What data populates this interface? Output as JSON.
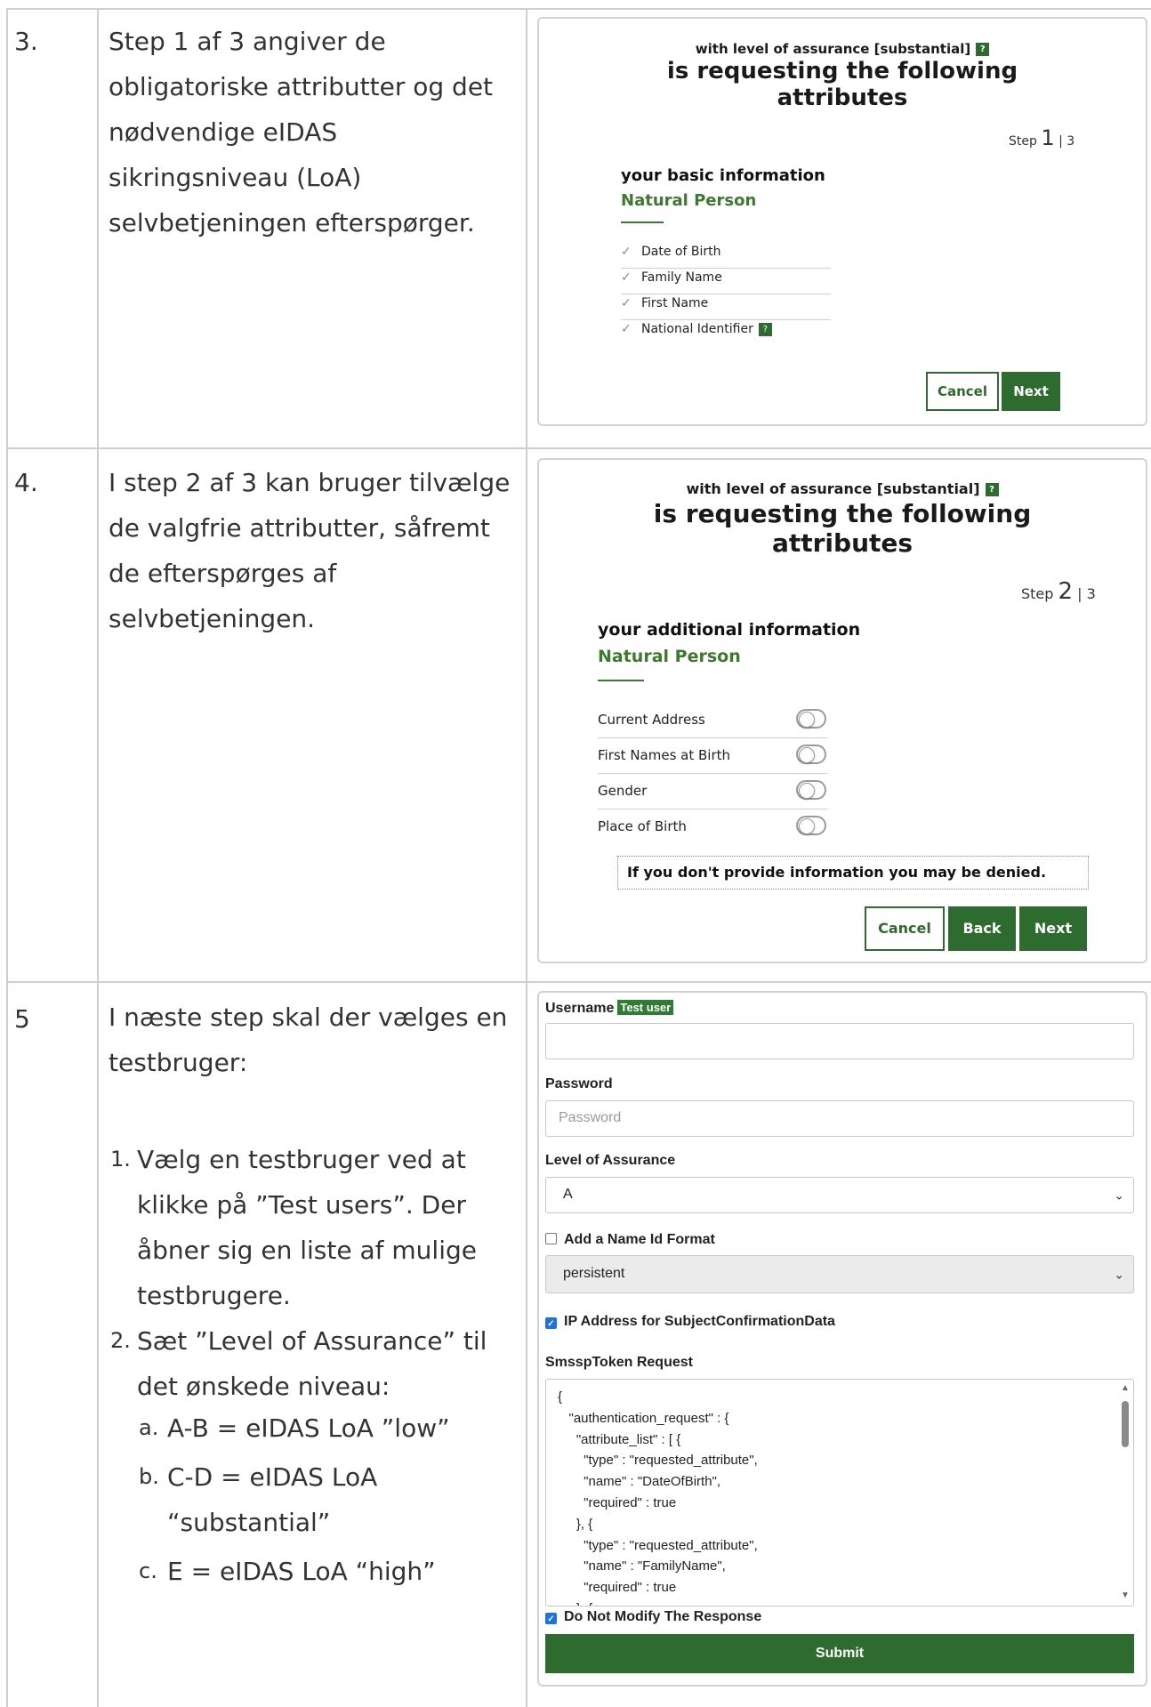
{
  "rows": [
    {
      "num": "3.",
      "text": "Step 1 af 3 angiver de obligatoriske attributter og det nødvendige eIDAS sikringsniveau (LoA) selvbetjeningen efterspørger."
    },
    {
      "num": "4.",
      "text": "I step 2 af 3 kan bruger tilvælge de valgfrie attributter, såfremt de efterspørges af selvbetjeningen."
    },
    {
      "num": "5",
      "intro": "I næste step skal der vælges en testbruger:",
      "items": [
        {
          "marker": "1.",
          "text": "Vælg en testbruger ved at klikke på ”Test users”. Der åbner sig en liste af mulige testbrugere."
        },
        {
          "marker": "2.",
          "text": "Sæt ”Level of Assurance” til det ønskede niveau:"
        }
      ],
      "subitems": [
        {
          "marker": "a.",
          "text": "A-B = eIDAS LoA ”low”"
        },
        {
          "marker": "b.",
          "text": "C-D = eIDAS LoA “substantial”"
        },
        {
          "marker": "c.",
          "text": "E = eIDAS LoA “high”"
        }
      ]
    }
  ],
  "screen1": {
    "loa_text": "with level of assurance [substantial]",
    "help_badge": "?",
    "heading_line1": "is requesting the following",
    "heading_line2": "attributes",
    "step_word": "Step",
    "step_current": "1",
    "step_total": "| 3",
    "section_title": "your basic information",
    "subject_type": "Natural Person",
    "check_icon": "✓",
    "attributes": [
      "Date of Birth",
      "Family Name",
      "First Name",
      "National Identifier"
    ],
    "cancel_label": "Cancel",
    "next_label": "Next"
  },
  "screen2": {
    "loa_text": "with level of assurance [substantial]",
    "help_badge": "?",
    "heading_line1": "is requesting the following",
    "heading_line2": "attributes",
    "step_word": "Step",
    "step_current": "2",
    "step_total": "| 3",
    "section_title": "your additional information",
    "subject_type": "Natural Person",
    "attributes": [
      "Current Address",
      "First Names at Birth",
      "Gender",
      "Place of Birth"
    ],
    "warning": "If you don't provide information you may be denied.",
    "cancel_label": "Cancel",
    "back_label": "Back",
    "next_label": "Next"
  },
  "screen3": {
    "username_label": "Username",
    "test_user_badge": "Test user",
    "username_value": "",
    "password_label": "Password",
    "password_placeholder": "Password",
    "loa_label": "Level of Assurance",
    "loa_value": "A",
    "name_id_checkbox_label": "Add a Name Id Format",
    "name_id_checked": false,
    "name_id_value": "persistent",
    "ip_checkbox_label": "IP Address for SubjectConfirmationData",
    "ip_checked": true,
    "token_label": "SmsspToken Request",
    "token_text": "{\n   \"authentication_request\" : {\n     \"attribute_list\" : [ {\n       \"type\" : \"requested_attribute\",\n       \"name\" : \"DateOfBirth\",\n       \"required\" : true\n     }, {\n       \"type\" : \"requested_attribute\",\n       \"name\" : \"FamilyName\",\n       \"required\" : true\n     }, {",
    "no_modify_label": "Do Not Modify The Response",
    "no_modify_checked": true,
    "submit_label": "Submit",
    "caret_icon": "⌄"
  },
  "colors": {
    "brand_green": "#2e6b2e",
    "checkbox_blue": "#1a73e8",
    "grid_line": "#cfcfcf"
  }
}
